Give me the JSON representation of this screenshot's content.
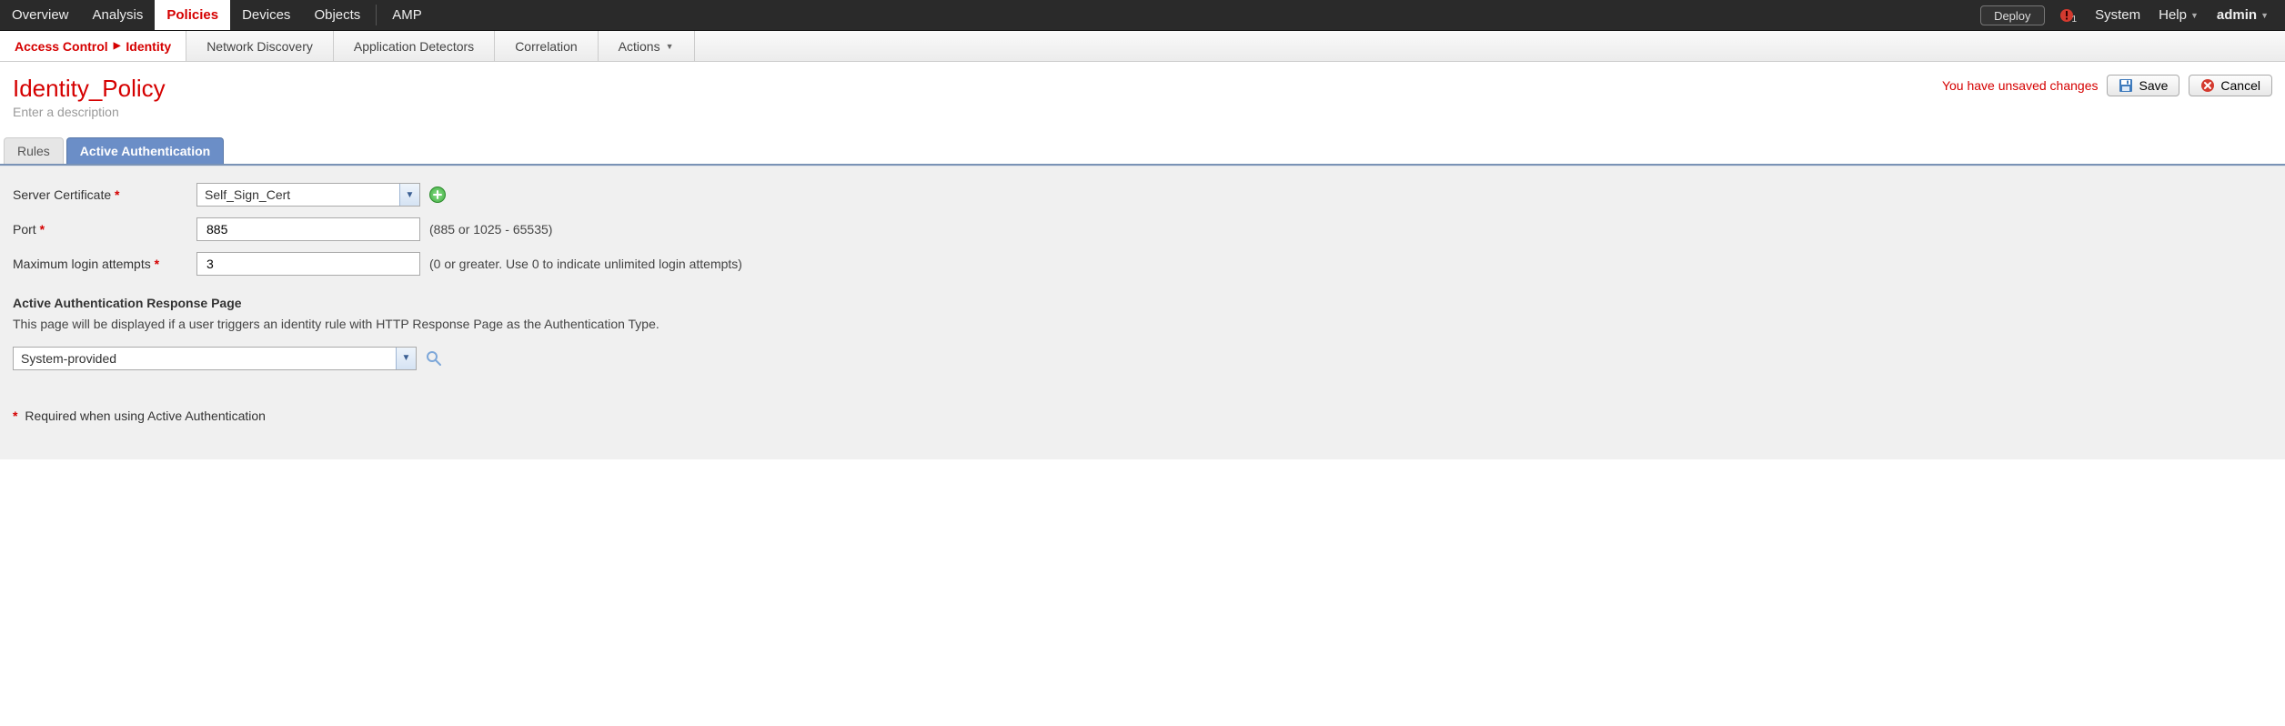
{
  "topnav": {
    "items": [
      "Overview",
      "Analysis",
      "Policies",
      "Devices",
      "Objects",
      "AMP"
    ],
    "active_index": 2,
    "deploy_label": "Deploy",
    "alert_count": "1",
    "right_items": [
      "System",
      "Help",
      "admin"
    ]
  },
  "subnav": {
    "crumb_parent": "Access Control",
    "crumb_child": "Identity",
    "items": [
      "Network Discovery",
      "Application Detectors",
      "Correlation",
      "Actions"
    ]
  },
  "title": {
    "policy_name": "Identity_Policy",
    "description_placeholder": "Enter a description",
    "unsaved_text": "You have unsaved changes",
    "save_label": "Save",
    "cancel_label": "Cancel"
  },
  "tabs": {
    "items": [
      "Rules",
      "Active Authentication"
    ],
    "active_index": 1
  },
  "form": {
    "server_cert_label": "Server Certificate",
    "server_cert_value": "Self_Sign_Cert",
    "port_label": "Port",
    "port_value": "885",
    "port_hint": "(885 or 1025 - 65535)",
    "max_attempts_label": "Maximum login attempts",
    "max_attempts_value": "3",
    "max_attempts_hint": "(0 or greater. Use 0 to indicate unlimited login attempts)",
    "response_heading": "Active Authentication Response Page",
    "response_desc": "This page will be displayed if a user triggers an identity rule with HTTP Response Page as the Authentication Type.",
    "response_page_value": "System-provided",
    "footnote": "Required when using Active Authentication"
  }
}
